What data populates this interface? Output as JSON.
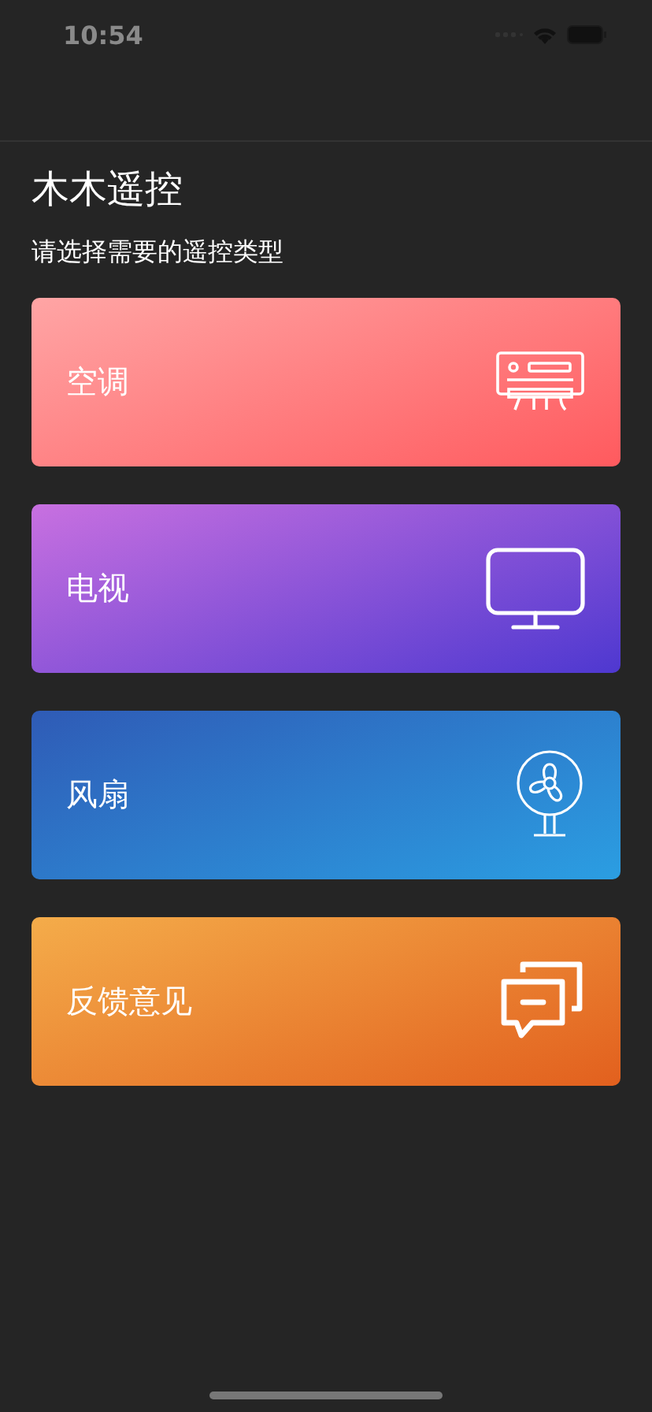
{
  "status_bar": {
    "time": "10:54"
  },
  "title": "木木遥控",
  "subtitle": "请选择需要的遥控类型",
  "cards": [
    {
      "kind": "ac",
      "label": "空调"
    },
    {
      "kind": "tv",
      "label": "电视"
    },
    {
      "kind": "fan",
      "label": "风扇"
    },
    {
      "kind": "feedback",
      "label": "反馈意见"
    }
  ]
}
